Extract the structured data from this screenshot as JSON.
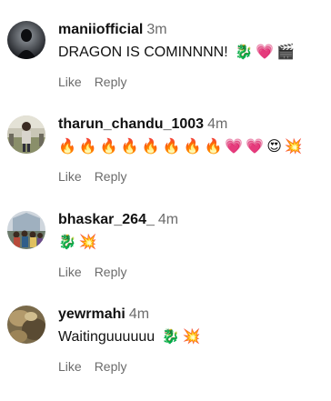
{
  "comments": [
    {
      "username": "maniiofficial",
      "time": "3m",
      "text": "DRAGON IS COMINNNN!",
      "emojis": [
        "🐉",
        "💗",
        "🎬"
      ],
      "like_label": "Like",
      "reply_label": "Reply",
      "avatar": "avatar-dark-figure"
    },
    {
      "username": "tharun_chandu_1003",
      "time": "4m",
      "text": "",
      "emojis": [
        "🔥",
        "🔥",
        "🔥",
        "🔥",
        "🔥",
        "🔥",
        "🔥",
        "🔥",
        "💗",
        "💗",
        "😍",
        "💥"
      ],
      "like_label": "Like",
      "reply_label": "Reply",
      "avatar": "avatar-outdoor-person"
    },
    {
      "username": "bhaskar_264_",
      "time": "4m",
      "text": "",
      "emojis": [
        "🐉",
        "💥"
      ],
      "like_label": "Like",
      "reply_label": "Reply",
      "avatar": "avatar-group-photo"
    },
    {
      "username": "yewrmahi",
      "time": "4m",
      "text": "Waitinguuuuuu",
      "emojis": [
        "🐉",
        "💥"
      ],
      "like_label": "Like",
      "reply_label": "Reply",
      "avatar": "avatar-painting"
    }
  ]
}
